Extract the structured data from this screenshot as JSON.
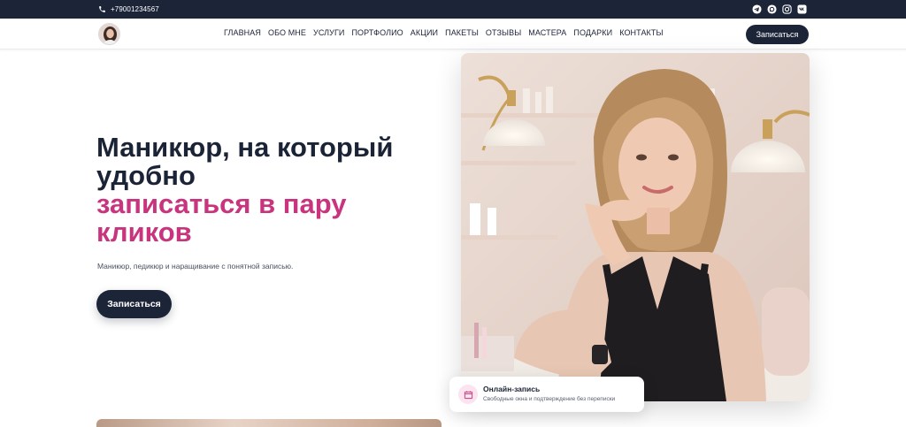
{
  "topbar": {
    "phone": "+79001234567",
    "socials": [
      "telegram-icon",
      "whatsapp-icon",
      "instagram-icon",
      "vk-icon"
    ]
  },
  "nav": {
    "links": [
      "ГЛАВНАЯ",
      "ОБО МНЕ",
      "УСЛУГИ",
      "ПОРТФОЛИО",
      "АКЦИИ",
      "ПАКЕТЫ",
      "ОТЗЫВЫ",
      "МАСТЕРА",
      "ПОДАРКИ",
      "КОНТАКТЫ"
    ],
    "cta": "Записаться"
  },
  "hero": {
    "title_line1": "Маникюр, на который",
    "title_line2": "удобно",
    "title_accent1": "записаться в пару",
    "title_accent2": "кликов",
    "subtitle": "Маникюр, педикюр и наращивание с понятной записью.",
    "cta": "Записаться"
  },
  "card": {
    "title": "Онлайн-запись",
    "text": "Свободные окна и подтверждение без переписки"
  },
  "colors": {
    "dark": "#1c2438",
    "accent": "#c8357e",
    "accent_bg": "#fbe3ef"
  }
}
